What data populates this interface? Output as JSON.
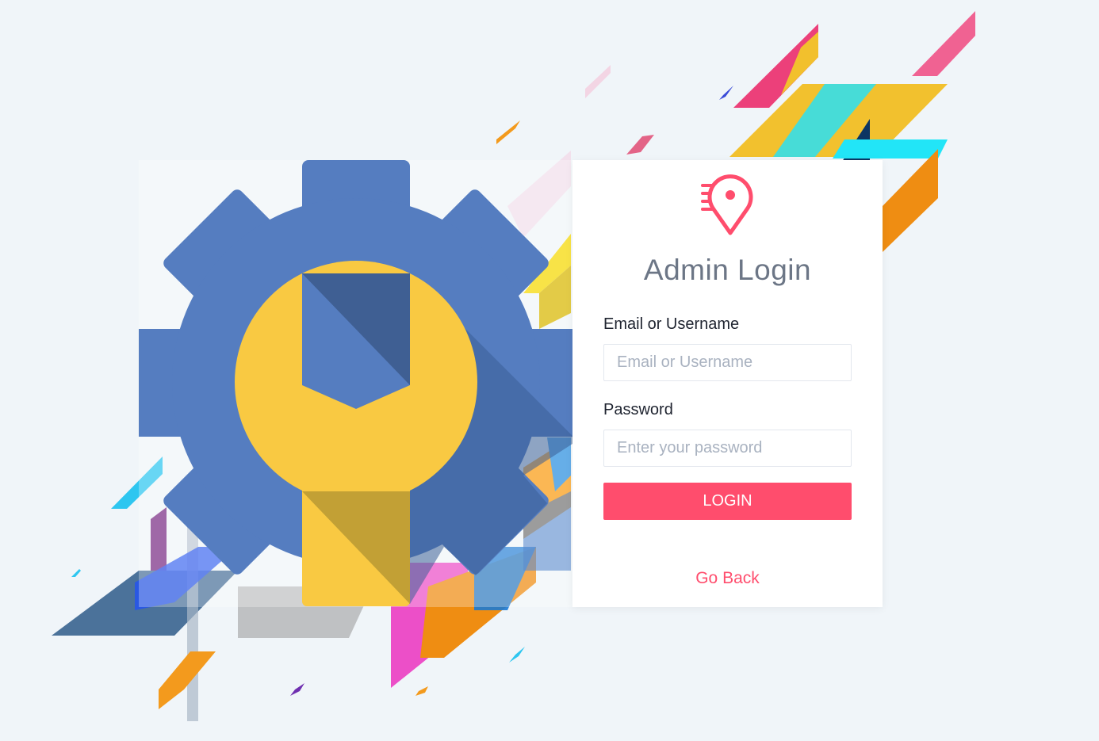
{
  "login": {
    "title": "Admin Login",
    "email_label": "Email or Username",
    "email_placeholder": "Email or Username",
    "email_value": "",
    "password_label": "Password",
    "password_placeholder": "Enter your password",
    "password_value": "",
    "login_label": "LOGIN",
    "go_back_label": "Go Back"
  },
  "icons": {
    "logo": "location-pin-speed-icon",
    "illustration": "gear-wrench-icon"
  },
  "colors": {
    "accent": "#ff4d6d",
    "background": "#f0f5f9",
    "gear": "#557dc0",
    "wrench": "#f9c942",
    "title": "#6c7686"
  }
}
